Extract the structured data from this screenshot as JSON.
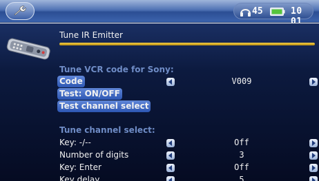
{
  "status_bar": {
    "tool_icon": "wrench-icon",
    "volume": "45",
    "clock": "10 01",
    "headphone_icon": "headphones-icon",
    "battery_icon": "battery-icon"
  },
  "page": {
    "title": "Tune IR Emitter",
    "device_icon": "remote-control-icon"
  },
  "sections": [
    {
      "heading": "Tune VCR code for Sony:",
      "rows": [
        {
          "label": "Code",
          "value": "V009",
          "has_arrows": true,
          "selected": true
        },
        {
          "label": "Test: ON/OFF",
          "selected": true
        },
        {
          "label": "Test channel select",
          "selected": true
        }
      ]
    },
    {
      "heading": "Tune channel select:",
      "rows": [
        {
          "label": "Key: -/--",
          "value": "Off",
          "has_arrows": true
        },
        {
          "label": "Number of digits",
          "value": "3",
          "has_arrows": true
        },
        {
          "label": "Key: Enter",
          "value": "Off",
          "has_arrows": true
        },
        {
          "label": "Key delay",
          "value": "5",
          "has_arrows": true
        }
      ]
    }
  ],
  "colors": {
    "topbar": "#3d64ad",
    "background": "#0c1a3f",
    "accent_rule": "#f4ce47",
    "section_heading": "#6f8cc6",
    "highlight": "#2c56b2"
  }
}
